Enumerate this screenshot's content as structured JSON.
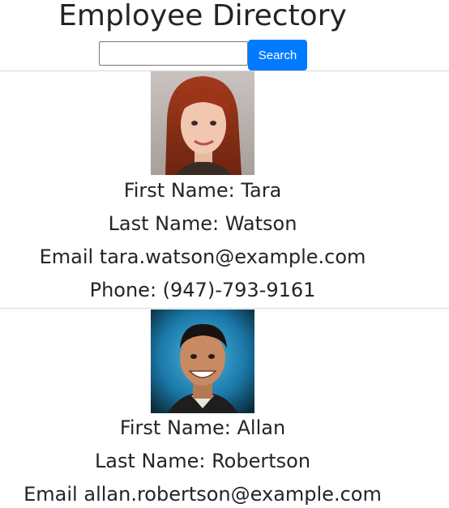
{
  "header": {
    "title": "Employee Directory"
  },
  "search": {
    "value": "",
    "placeholder": "",
    "button_label": "Search"
  },
  "employees": [
    {
      "first_name_label": "First Name: Tara",
      "last_name_label": "Last Name: Watson",
      "email_label": "Email tara.watson@example.com",
      "phone_label": "Phone: (947)-793-9161"
    },
    {
      "first_name_label": "First Name: Allan",
      "last_name_label": "Last Name: Robertson",
      "email_label": "Email allan.robertson@example.com"
    }
  ],
  "colors": {
    "primary_button": "#007bff",
    "text": "#212529",
    "divider": "#d9d9d9"
  }
}
